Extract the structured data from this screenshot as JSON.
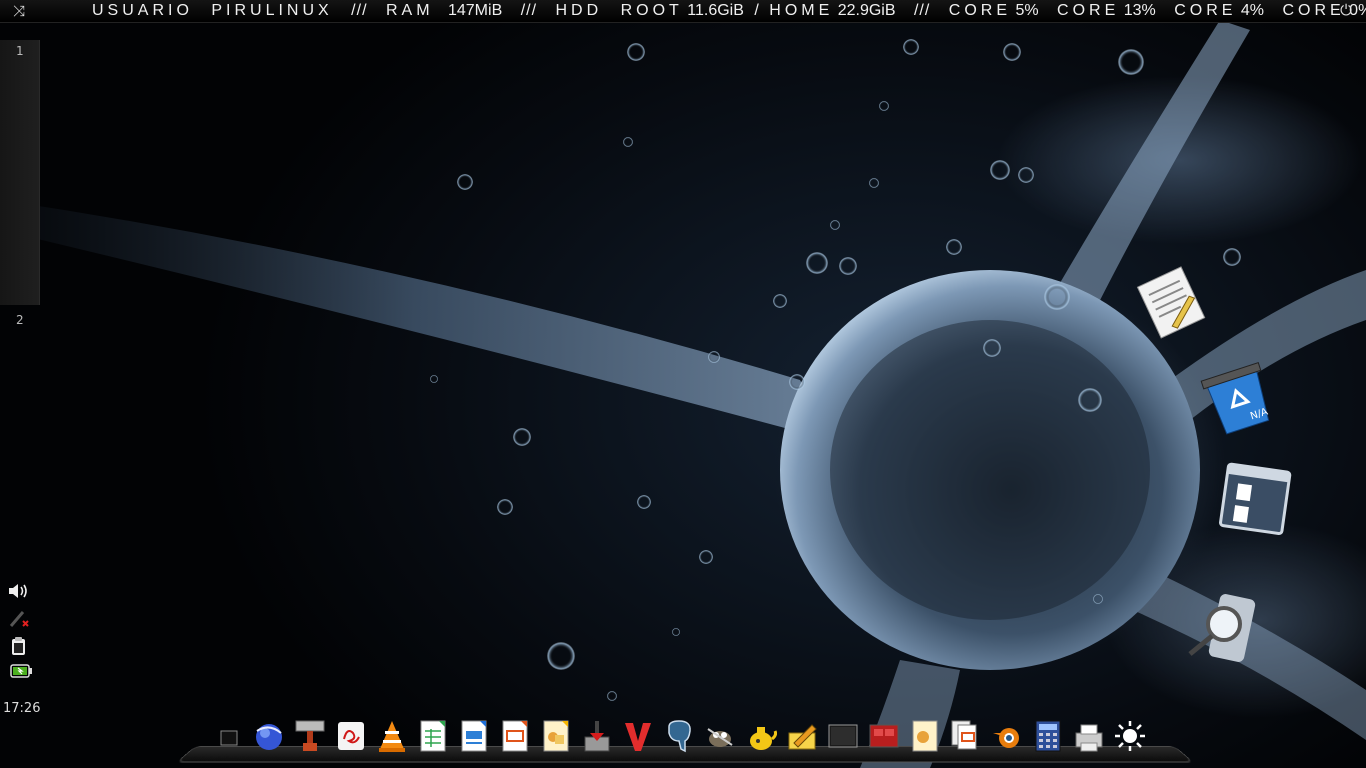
{
  "topbar": {
    "user_label": "USUARIO",
    "user_name": "PIRULINUX",
    "separator": "///",
    "ram_label": "RAM",
    "ram_value": "147MiB",
    "hdd_label": "HDD",
    "root_label": "ROOT",
    "root_value": "11.6GiB",
    "slash": "/",
    "home_label": "HOME",
    "home_value": "22.9GiB",
    "core_label": "CORE",
    "cores": [
      "5%",
      "13%",
      "4%",
      "0%"
    ]
  },
  "workspaces": [
    "1",
    "2"
  ],
  "clock": "17:26",
  "tray_icons": [
    "volume-icon",
    "network-disconnected-icon",
    "clipboard-icon",
    "battery-icon"
  ],
  "desktop_icons": [
    "text-editor-icon",
    "trash-icon",
    "file-manager-icon",
    "search-icon"
  ],
  "dock_icons": [
    "show-desktop-icon",
    "web-browser-icon",
    "disk-utility-icon",
    "pdf-reader-icon",
    "vlc-icon",
    "spreadsheet-icon",
    "writer-icon",
    "presentation-icon",
    "draw-icon",
    "installer-icon",
    "vivaldi-icon",
    "postgresql-icon",
    "gimp-icon",
    "teapot-icon",
    "notes-icon",
    "terminal-icon",
    "media-icon",
    "image-viewer-icon",
    "documents-icon",
    "blender-icon",
    "calculator-icon",
    "printer-icon",
    "brightness-icon"
  ]
}
